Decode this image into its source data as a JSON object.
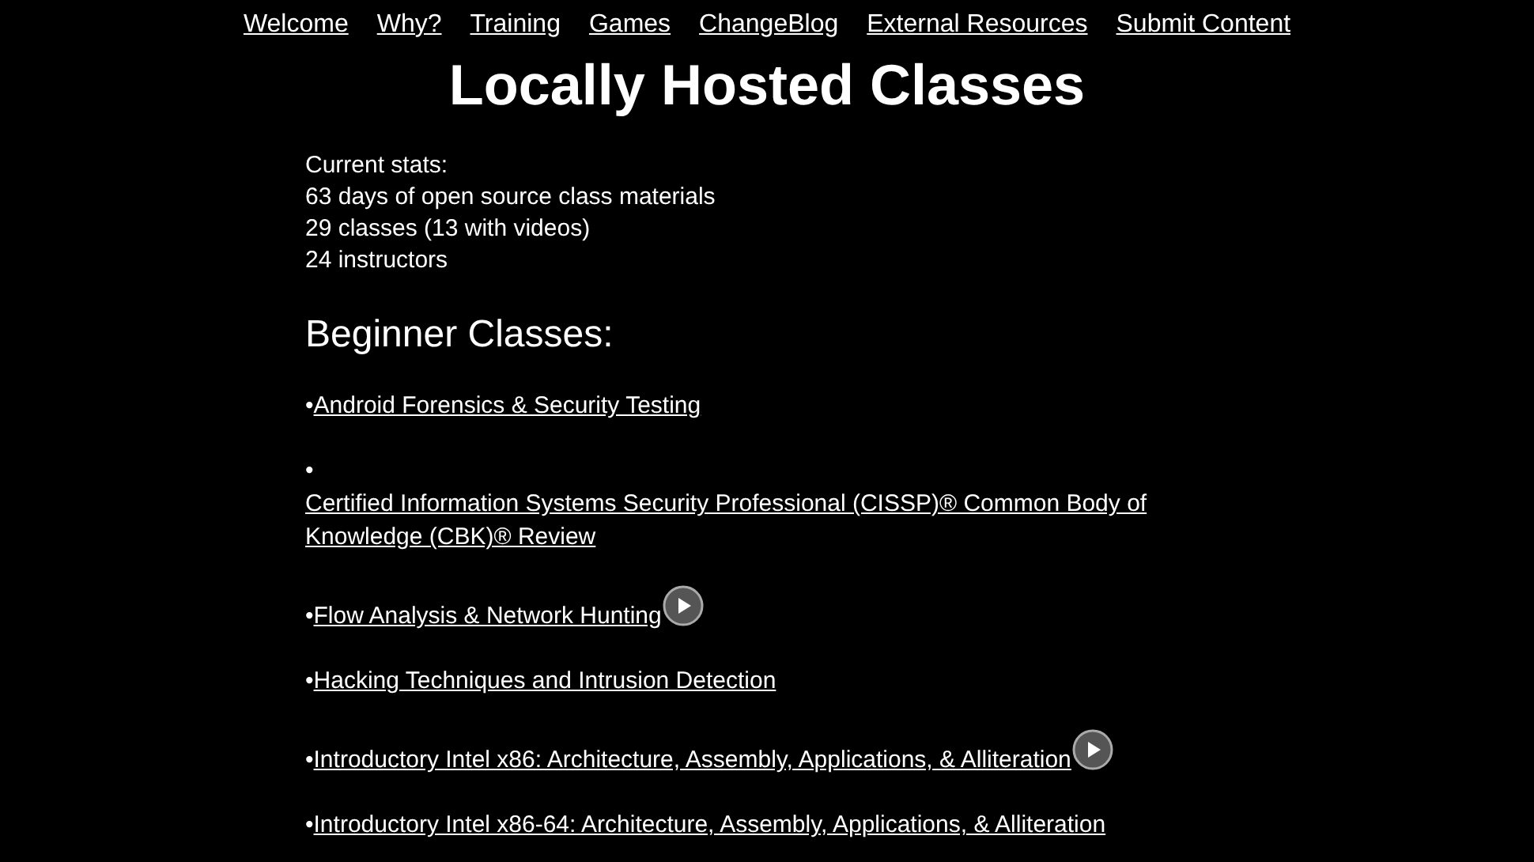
{
  "nav": [
    {
      "label": "Welcome"
    },
    {
      "label": "Why?"
    },
    {
      "label": "Training"
    },
    {
      "label": "Games"
    },
    {
      "label": "ChangeBlog"
    },
    {
      "label": "External Resources"
    },
    {
      "label": "Submit Content"
    }
  ],
  "title": "Locally Hosted Classes",
  "stats": [
    "Current stats:",
    "63 days of open source class materials",
    "29 classes (13 with videos)",
    "24 instructors"
  ],
  "section_heading": "Beginner Classes:",
  "classes": [
    {
      "bullet": "•",
      "title": "Android Forensics & Security Testing",
      "has_video": false
    },
    {
      "bullet": "•",
      "title": "Certified Information Systems Security Professional (CISSP)® Common Body of Knowledge (CBK)® Review",
      "has_video": false
    },
    {
      "bullet": "•",
      "title": "Flow Analysis & Network Hunting",
      "has_video": true
    },
    {
      "bullet": "•",
      "title": "Hacking Techniques and Intrusion Detection",
      "has_video": false
    },
    {
      "bullet": "•",
      "title": "Introductory Intel x86: Architecture, Assembly, Applications, & Alliteration",
      "has_video": true
    },
    {
      "bullet": "•",
      "title": "Introductory Intel x86-64: Architecture, Assembly, Applications, & Alliteration",
      "has_video": false
    }
  ]
}
